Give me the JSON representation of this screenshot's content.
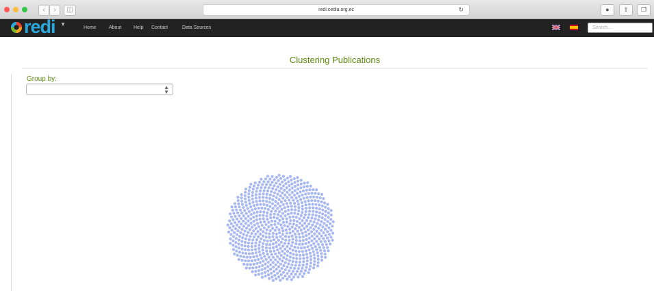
{
  "browser": {
    "url": "redi.cedia.org.ec",
    "reload_icon": "reload-icon",
    "buttons": [
      "back-icon",
      "forward-icon",
      "sidebar-icon",
      "download-icon",
      "share-icon",
      "tabs-icon"
    ]
  },
  "navbar": {
    "brand": "redi",
    "items": [
      "Home",
      "About",
      "Help",
      "Contact",
      "Data Sources"
    ],
    "flags": [
      "uk-flag-icon",
      "spain-flag-icon"
    ],
    "search_placeholder": "Search..."
  },
  "main": {
    "title": "Clustering Publications",
    "group_by_label": "Group by:",
    "group_by_value": ""
  },
  "colors": {
    "navbar": "#222222",
    "accent_green": "#5c8a0b",
    "brand_blue": "#2aa9dc",
    "node": "#a7b7f0"
  },
  "visualization": {
    "type": "force-directed cluster",
    "node_count": 750
  }
}
